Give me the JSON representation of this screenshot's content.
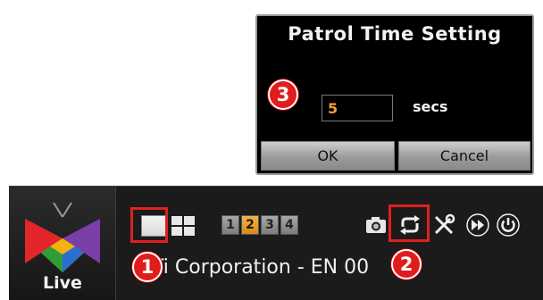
{
  "dialog": {
    "title": "Patrol Time Setting",
    "time_value": "5",
    "unit_label": "secs",
    "ok_label": "OK",
    "cancel_label": "Cancel"
  },
  "toolbar": {
    "live_label": "Live",
    "layout_buttons": [
      "single-view-icon",
      "quad-view-icon"
    ],
    "group_buttons": [
      "1",
      "2",
      "3",
      "4"
    ],
    "active_group": "2",
    "icons": [
      "camera-snapshot-icon",
      "patrol-loop-icon",
      "settings-tools-icon",
      "fast-forward-icon",
      "power-icon"
    ],
    "scrolling_text": "Ti Corporation - EN  00"
  },
  "annotations": {
    "badge_1": "1",
    "badge_2": "2",
    "badge_3": "3",
    "badge_color": "#e01c1c"
  },
  "colors": {
    "input_text": "#f0a030",
    "active_group": "#e8a03a",
    "toolbar_bg": "#1b1b1b"
  }
}
